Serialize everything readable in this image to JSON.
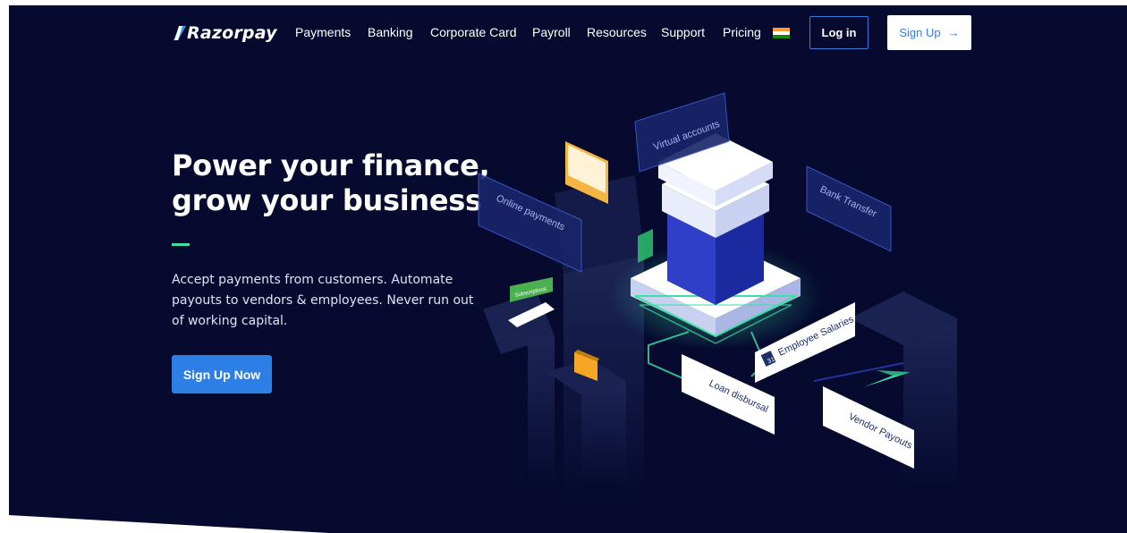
{
  "brand": {
    "name": "Razorpay"
  },
  "nav": {
    "items": [
      "Payments",
      "Banking",
      "Corporate Card",
      "Payroll",
      "Resources",
      "Support",
      "Pricing"
    ],
    "login_label": "Log in",
    "signup_label": "Sign Up",
    "signup_icon": "arrow-right-icon",
    "country_icon": "india-flag-icon"
  },
  "hero": {
    "title_line1": "Power your finance,",
    "title_line2": "grow your business",
    "subtitle": "Accept payments from customers. Automate payouts to vendors & employees. Never run out of working capital.",
    "cta_label": "Sign Up Now"
  },
  "illustration": {
    "labels": {
      "virtual_accounts": "Virtual accounts",
      "online_payments": "Online payments",
      "bank_transfer": "Bank Transfer",
      "employee_salaries": "Employee Salaries",
      "loan_disbursal": "Loan disbursal",
      "vendor_payouts": "Vendor Payouts",
      "subscriptions": "Subscriptions",
      "calendar_day": "31"
    }
  },
  "colors": {
    "background": "#050a2e",
    "accent_blue": "#2d7fe6",
    "accent_green": "#3ee0a6",
    "white": "#ffffff"
  }
}
